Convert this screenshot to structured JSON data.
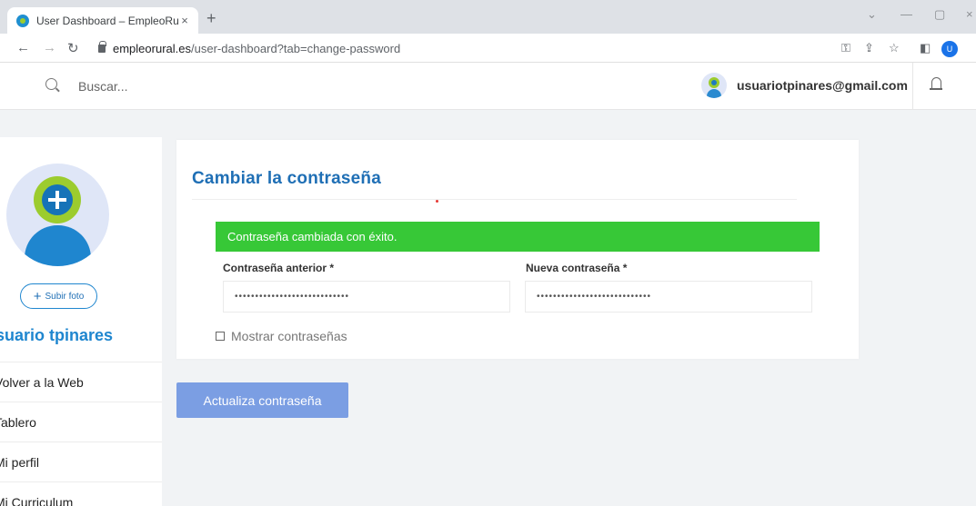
{
  "browser": {
    "tab_title": "User Dashboard – EmpleoRural",
    "tab_close": "×",
    "new_tab": "+",
    "url_host": "empleorural.es",
    "url_path": "/user-dashboard?tab=change-password",
    "profile_initial": "U",
    "icons": [
      "back-arrow-icon",
      "forward-arrow-icon",
      "reload-icon",
      "key-icon",
      "share-icon",
      "star-icon",
      "sidepanel-icon"
    ]
  },
  "header": {
    "search_placeholder": "Buscar...",
    "user_email": "usuariotpinares@gmail.com"
  },
  "sidebar": {
    "upload_label": "Subir foto",
    "user_name": "Usuario tpinares",
    "items": [
      {
        "label": "Volver a la Web"
      },
      {
        "label": "Tablero"
      },
      {
        "label": "Mi perfil"
      },
      {
        "label": "Mi Curriculum"
      }
    ]
  },
  "main": {
    "title": "Cambiar la contraseña",
    "success_message": "Contraseña cambiada con éxito.",
    "old_password_label": "Contraseña anterior *",
    "old_password_value": "••••••••••••••••••••••••••••",
    "new_password_label": "Nueva contraseña *",
    "new_password_value": "••••••••••••••••••••••••••••",
    "show_passwords_label": "Mostrar contraseñas",
    "submit_label": "Actualiza contraseña"
  },
  "colors": {
    "accent": "#1f86cf",
    "success": "#37c837",
    "button": "#7b9ee3"
  }
}
